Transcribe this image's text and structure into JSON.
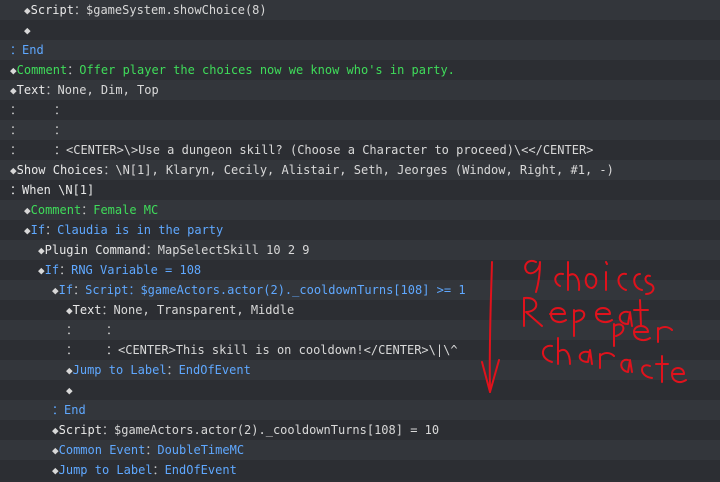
{
  "lines": [
    {
      "indent": 24,
      "diamond": true,
      "label": "Script",
      "sep": "：",
      "value": "$gameSystem.showChoice(8)",
      "label_color": "white",
      "value_color": "val"
    },
    {
      "indent": 24,
      "diamond": true,
      "label": "",
      "sep": "",
      "value": "",
      "label_color": "white",
      "value_color": "val"
    },
    {
      "indent": 10,
      "diamond": false,
      "label": "：End",
      "sep": "",
      "value": "",
      "label_color": "blue",
      "value_color": "val"
    },
    {
      "indent": 10,
      "diamond": true,
      "label": "Comment",
      "sep": "：",
      "value": "Offer player the choices now we know who's in party.",
      "label_color": "green",
      "value_color": "green"
    },
    {
      "indent": 10,
      "diamond": true,
      "label": "Text",
      "sep": "：",
      "value": "None, Dim, Top",
      "label_color": "white",
      "value_color": "val"
    },
    {
      "indent": 10,
      "diamond": false,
      "label": "：",
      "sep": "",
      "value": "：",
      "label_color": "dim",
      "value_color": "dim",
      "value_offset": 44
    },
    {
      "indent": 10,
      "diamond": false,
      "label": "：",
      "sep": "",
      "value": "：",
      "label_color": "dim",
      "value_color": "dim",
      "value_offset": 44
    },
    {
      "indent": 10,
      "diamond": false,
      "label": "：",
      "sep": "",
      "value": "：<CENTER>\\>Use a dungeon skill? (Choose a Character to proceed)\\<</CENTER>",
      "label_color": "dim",
      "value_color": "val",
      "value_offset": 44
    },
    {
      "indent": 10,
      "diamond": true,
      "label": "Show Choices",
      "sep": "：",
      "value": "\\N[1], Klaryn, Cecily, Alistair, Seth, Jeorges (Window, Right, #1, -)",
      "label_color": "white",
      "value_color": "val"
    },
    {
      "indent": 10,
      "diamond": false,
      "label": "：When \\N[1]",
      "sep": "",
      "value": "",
      "label_color": "white",
      "value_color": "val"
    },
    {
      "indent": 24,
      "diamond": true,
      "label": "Comment",
      "sep": "：",
      "value": "Female MC",
      "label_color": "green",
      "value_color": "green"
    },
    {
      "indent": 24,
      "diamond": true,
      "label": "If",
      "sep": "：",
      "value": "Claudia is in the party",
      "label_color": "blue",
      "value_color": "blue"
    },
    {
      "indent": 38,
      "diamond": true,
      "label": "Plugin Command",
      "sep": "：",
      "value": "MapSelectSkill 10 2 9",
      "label_color": "white",
      "value_color": "val"
    },
    {
      "indent": 38,
      "diamond": true,
      "label": "If",
      "sep": "：",
      "value": "RNG Variable = 108",
      "label_color": "blue",
      "value_color": "blue"
    },
    {
      "indent": 52,
      "diamond": true,
      "label": "If",
      "sep": "：",
      "value": "Script：$gameActors.actor(2)._cooldownTurns[108] >= 1",
      "label_color": "blue",
      "value_color": "blue"
    },
    {
      "indent": 66,
      "diamond": true,
      "label": "Text",
      "sep": "：",
      "value": "None, Transparent, Middle",
      "label_color": "white",
      "value_color": "val"
    },
    {
      "indent": 66,
      "diamond": false,
      "label": "：",
      "sep": "",
      "value": "：",
      "label_color": "dim",
      "value_color": "dim",
      "value_offset": 40
    },
    {
      "indent": 66,
      "diamond": false,
      "label": "：",
      "sep": "",
      "value": "：<CENTER>This skill is on cooldown!</CENTER>\\|\\^",
      "label_color": "dim",
      "value_color": "val",
      "value_offset": 40
    },
    {
      "indent": 66,
      "diamond": true,
      "label": "Jump to Label",
      "sep": "：",
      "value": "EndOfEvent",
      "label_color": "blue",
      "value_color": "blue"
    },
    {
      "indent": 66,
      "diamond": true,
      "label": "",
      "sep": "",
      "value": "",
      "label_color": "white",
      "value_color": "val"
    },
    {
      "indent": 52,
      "diamond": false,
      "label": "：End",
      "sep": "",
      "value": "",
      "label_color": "blue",
      "value_color": "val"
    },
    {
      "indent": 52,
      "diamond": true,
      "label": "Script",
      "sep": "：",
      "value": "$gameActors.actor(2)._cooldownTurns[108] = 10",
      "label_color": "white",
      "value_color": "val"
    },
    {
      "indent": 52,
      "diamond": true,
      "label": "Common Event",
      "sep": "：",
      "value": "DoubleTimeMC",
      "label_color": "blue",
      "value_color": "blue"
    },
    {
      "indent": 52,
      "diamond": true,
      "label": "Jump to Label",
      "sep": "：",
      "value": "EndOfEvent",
      "label_color": "blue",
      "value_color": "blue"
    }
  ],
  "annotation": {
    "lines_of_text": [
      "9 choices",
      "Repeat per",
      "character"
    ],
    "color": "#e0121c"
  },
  "colors": {
    "background": "#2f3136",
    "white": "#e8e8e8",
    "green": "#3fdc5a",
    "blue": "#5fa8ff"
  }
}
